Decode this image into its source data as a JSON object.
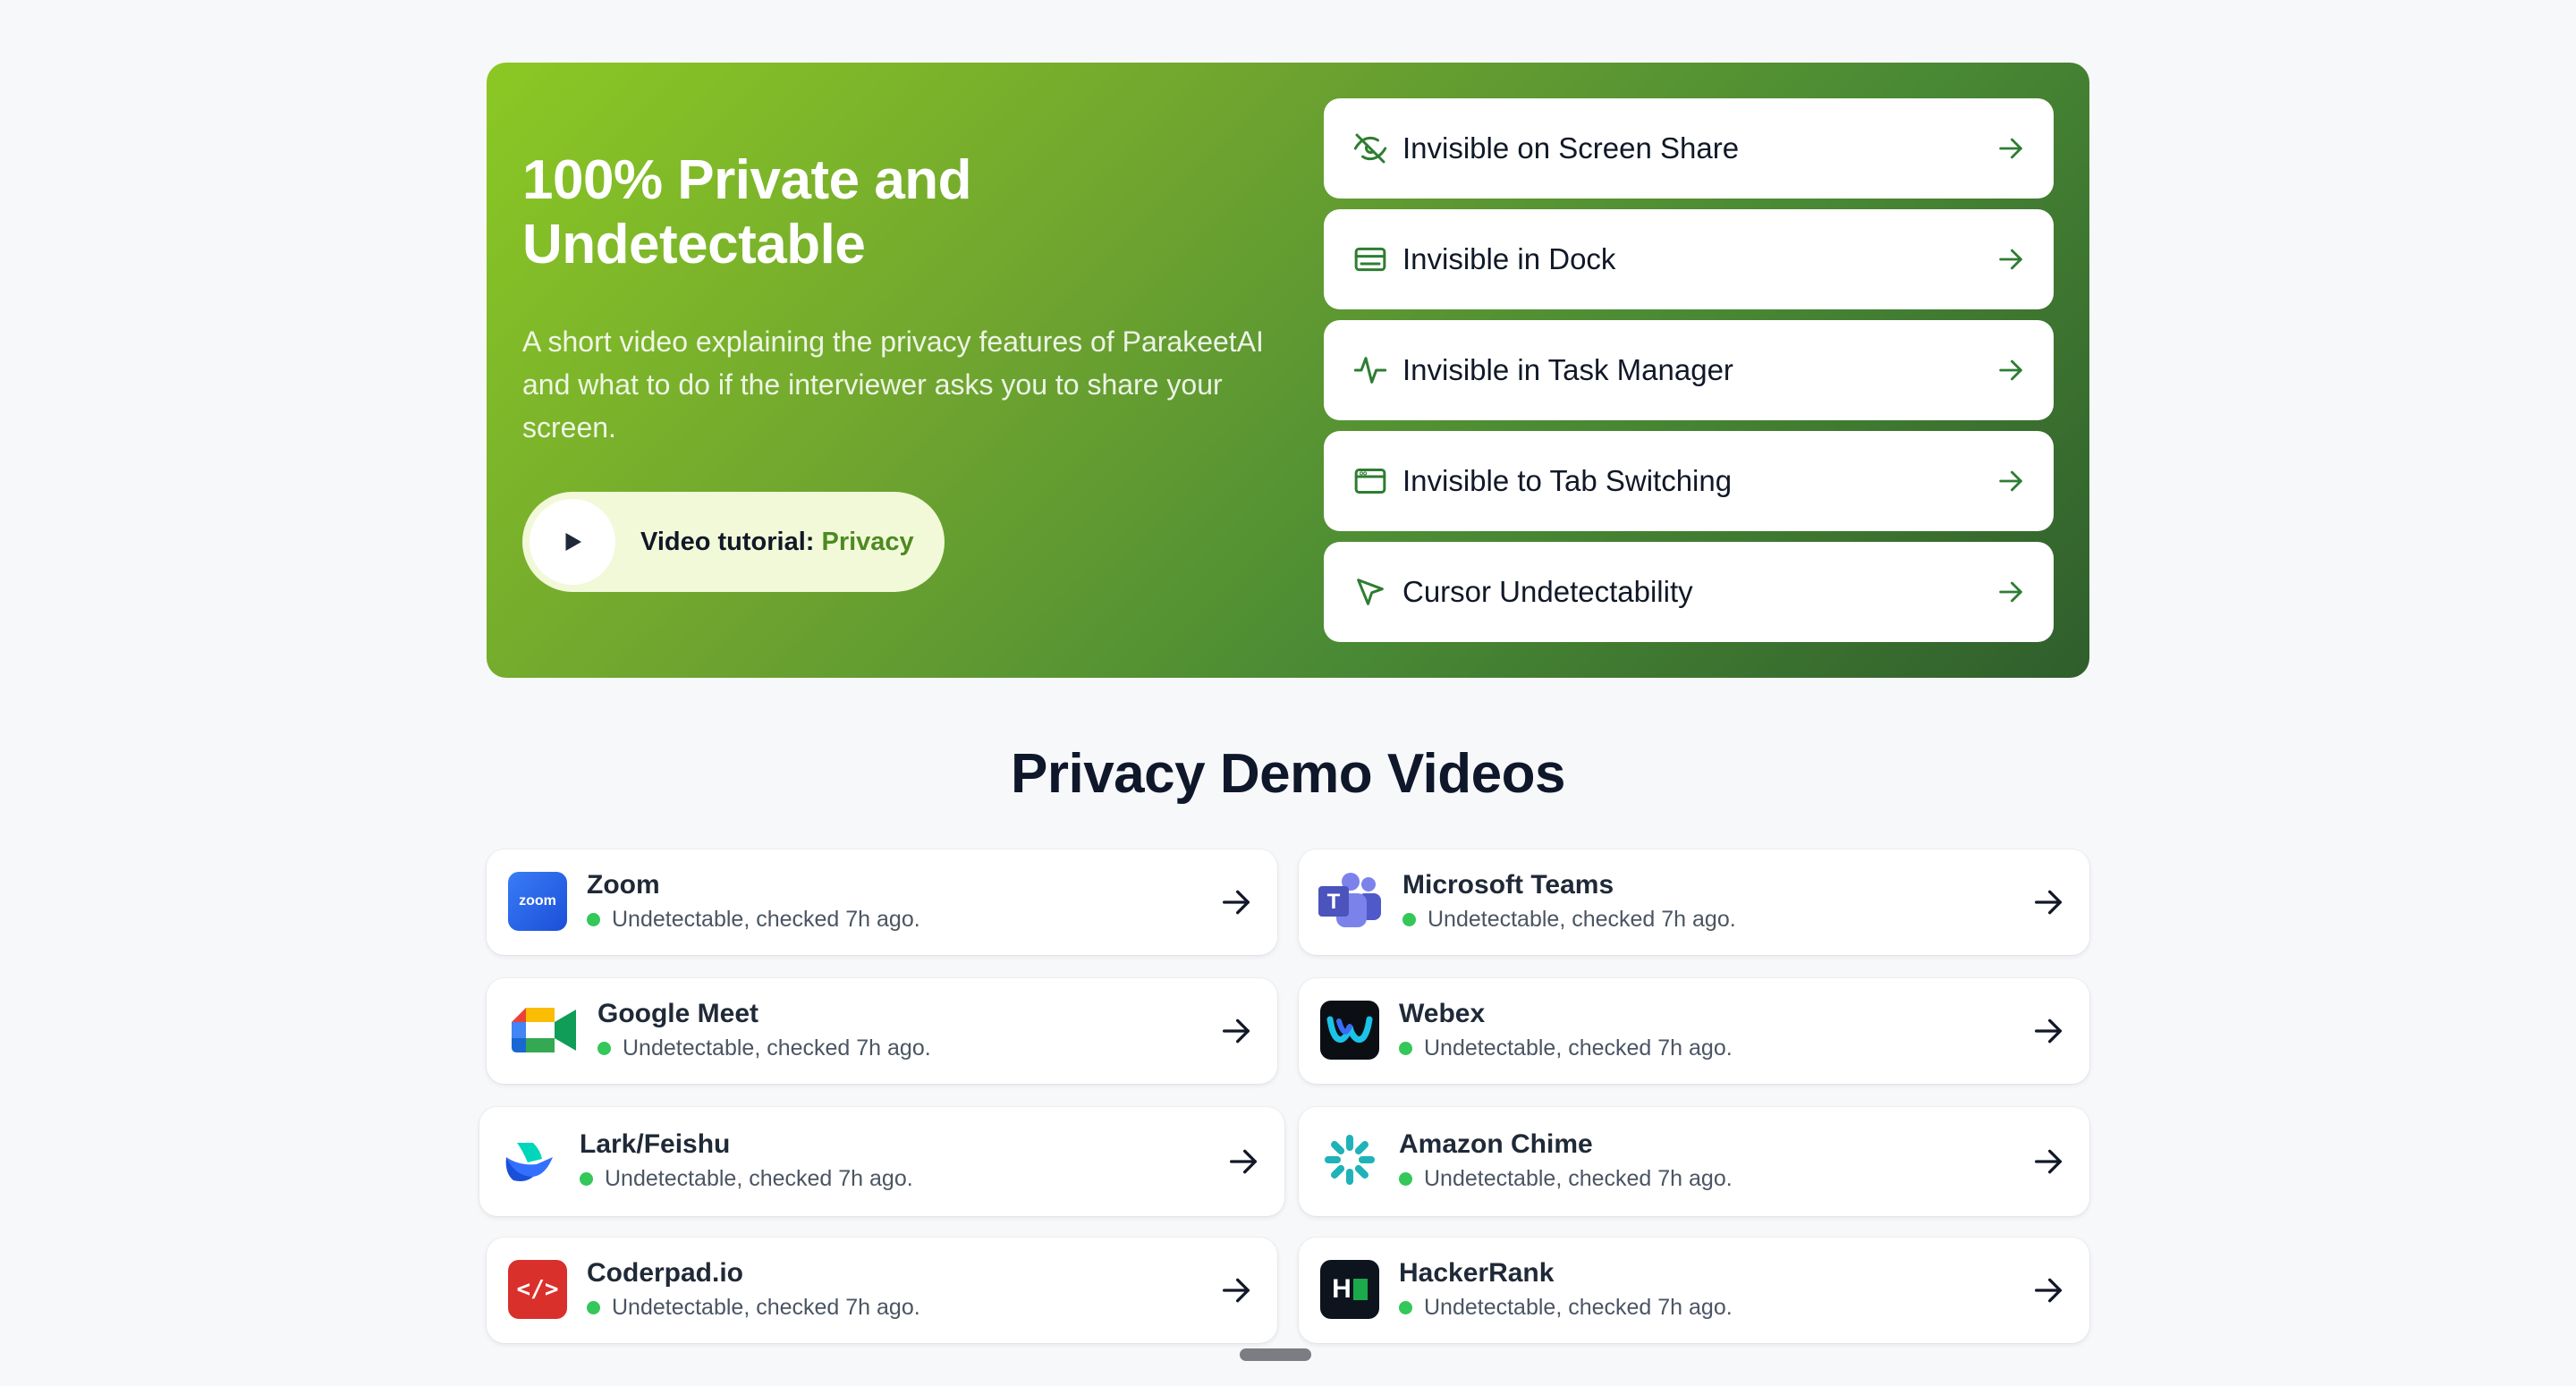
{
  "hero": {
    "title": "100% Private and Undetectable",
    "description": "A short video explaining the privacy features of ParakeetAI and what to do if the interviewer asks you to share your screen.",
    "video_label": "Video tutorial: ",
    "video_accent": "Privacy",
    "features": [
      {
        "label": "Invisible on Screen Share",
        "icon": "eye-off-icon"
      },
      {
        "label": "Invisible in Dock",
        "icon": "dock-icon"
      },
      {
        "label": "Invisible in Task Manager",
        "icon": "activity-icon"
      },
      {
        "label": "Invisible to Tab Switching",
        "icon": "app-window-icon"
      },
      {
        "label": "Cursor Undetectability",
        "icon": "cursor-icon"
      }
    ]
  },
  "section": {
    "title": "Privacy Demo Videos"
  },
  "apps": [
    {
      "name": "Zoom",
      "status": "Undetectable, checked 7h ago.",
      "logo_text": "zoom"
    },
    {
      "name": "Microsoft Teams",
      "status": "Undetectable, checked 7h ago."
    },
    {
      "name": "Google Meet",
      "status": "Undetectable, checked 7h ago."
    },
    {
      "name": "Webex",
      "status": "Undetectable, checked 7h ago."
    },
    {
      "name": "Lark/Feishu",
      "status": "Undetectable, checked 7h ago."
    },
    {
      "name": "Amazon Chime",
      "status": "Undetectable, checked 7h ago."
    },
    {
      "name": "Coderpad.io",
      "status": "Undetectable, checked 7h ago.",
      "logo_text": "</>"
    },
    {
      "name": "HackerRank",
      "status": "Undetectable, checked 7h ago.",
      "logo_text": "H"
    }
  ],
  "colors": {
    "accent_green": "#4d8a22",
    "status_dot": "#34c759"
  }
}
